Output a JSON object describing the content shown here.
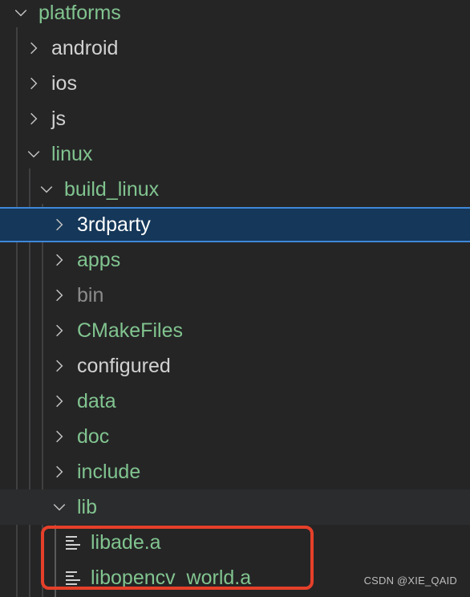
{
  "explorer": {
    "items": [
      {
        "label": "platforms",
        "type": "folder",
        "expanded": true,
        "depth": 0,
        "color": "green"
      },
      {
        "label": "android",
        "type": "folder",
        "expanded": false,
        "depth": 1,
        "color": "white"
      },
      {
        "label": "ios",
        "type": "folder",
        "expanded": false,
        "depth": 1,
        "color": "white"
      },
      {
        "label": "js",
        "type": "folder",
        "expanded": false,
        "depth": 1,
        "color": "white"
      },
      {
        "label": "linux",
        "type": "folder",
        "expanded": true,
        "depth": 1,
        "color": "green"
      },
      {
        "label": "build_linux",
        "type": "folder",
        "expanded": true,
        "depth": 2,
        "color": "green"
      },
      {
        "label": "3rdparty",
        "type": "folder",
        "expanded": false,
        "depth": 3,
        "color": "bright",
        "selected": true
      },
      {
        "label": "apps",
        "type": "folder",
        "expanded": false,
        "depth": 3,
        "color": "green"
      },
      {
        "label": "bin",
        "type": "folder",
        "expanded": false,
        "depth": 3,
        "color": "gray"
      },
      {
        "label": "CMakeFiles",
        "type": "folder",
        "expanded": false,
        "depth": 3,
        "color": "green"
      },
      {
        "label": "configured",
        "type": "folder",
        "expanded": false,
        "depth": 3,
        "color": "white"
      },
      {
        "label": "data",
        "type": "folder",
        "expanded": false,
        "depth": 3,
        "color": "green"
      },
      {
        "label": "doc",
        "type": "folder",
        "expanded": false,
        "depth": 3,
        "color": "green"
      },
      {
        "label": "include",
        "type": "folder",
        "expanded": false,
        "depth": 3,
        "color": "green"
      },
      {
        "label": "lib",
        "type": "folder",
        "expanded": true,
        "depth": 3,
        "color": "green",
        "hover": true
      },
      {
        "label": "libade.a",
        "type": "file",
        "depth": 4,
        "color": "green"
      },
      {
        "label": "libopencv_world.a",
        "type": "file",
        "depth": 4,
        "color": "green"
      }
    ]
  },
  "annotation": {
    "highlight_color": "#e5402a",
    "highlighted_items": [
      "libade.a",
      "libopencv_world.a"
    ]
  },
  "watermark": "CSDN @XIE_QAID",
  "colors": {
    "green": "#81c48f",
    "selection_bg": "#153759",
    "selection_border": "#3f87d8",
    "background": "#252526"
  }
}
